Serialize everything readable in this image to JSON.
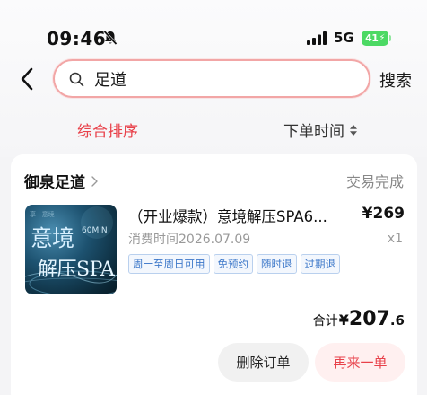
{
  "status_bar": {
    "time": "09:46",
    "network": "5G",
    "battery": "41"
  },
  "search": {
    "query": "足道",
    "button_label": "搜索"
  },
  "sort_tabs": [
    {
      "label": "综合排序",
      "active": true
    },
    {
      "label": "下单时间",
      "active": false
    }
  ],
  "order": {
    "shop_name": "御泉足道",
    "status": "交易完成",
    "product_title": "（开业爆款）意境解压SPA6...",
    "price": "¥269",
    "consume_time": "消费时间2026.07.09",
    "quantity": "x1",
    "tags": [
      "周一至周日可用",
      "免预约",
      "随时退",
      "过期退"
    ],
    "thumbnail": {
      "line1": "意境",
      "line2": "60MIN",
      "line3": "解压SPA"
    },
    "total": {
      "label": "合计",
      "currency": "¥",
      "integer": "207",
      "decimal": ".6"
    },
    "actions": {
      "delete": "删除订单",
      "reorder": "再来一单"
    }
  },
  "colors": {
    "accent": "#e8414a",
    "tag_blue": "#3d78c9",
    "battery_green": "#4cd964"
  }
}
